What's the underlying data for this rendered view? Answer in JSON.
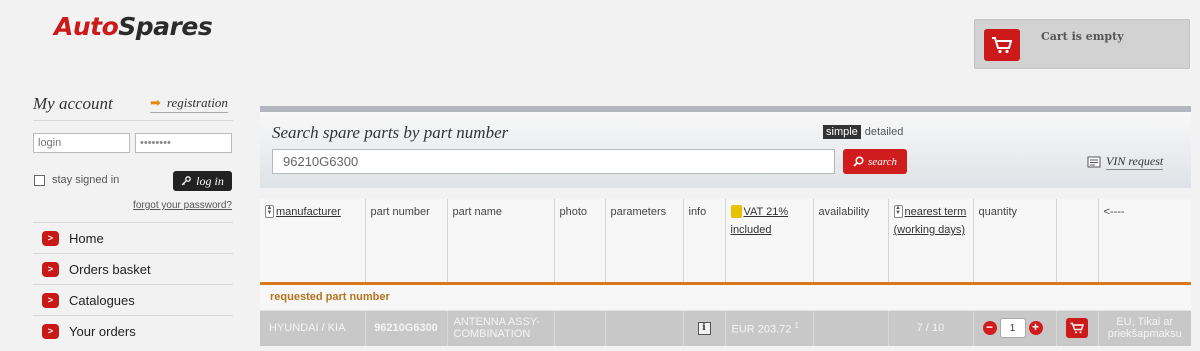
{
  "logo": {
    "part1": "Auto",
    "part2": "Spares"
  },
  "cart": {
    "status": "Cart is empty",
    "icon": "cart-icon"
  },
  "account": {
    "title": "My account",
    "registration": "registration",
    "login_placeholder": "login",
    "password_value": "••••••••",
    "stay_signed_in": "stay signed in",
    "login_button": "log in",
    "forgot_password": "forgot your password?"
  },
  "menu": {
    "items": [
      {
        "label": "Home"
      },
      {
        "label": "Orders basket"
      },
      {
        "label": "Catalogues"
      },
      {
        "label": "Your orders"
      }
    ]
  },
  "search": {
    "title": "Search spare parts by part number",
    "mode_simple": "simple",
    "mode_detailed": "detailed",
    "value": "96210G6300",
    "button": "search",
    "vin_request": "VIN request"
  },
  "table": {
    "headers": {
      "manufacturer": "manufacturer",
      "part_number": "part number",
      "part_name": "part name",
      "photo": "photo",
      "parameters": "parameters",
      "info": "info",
      "vat": "VAT 21% included",
      "availability": "availability",
      "nearest_term": "nearest term",
      "working_days": "(working days)",
      "quantity": "quantity",
      "back": "<----"
    },
    "section_label": "requested part number",
    "rows": [
      {
        "manufacturer": "HYUNDAI / KIA",
        "part_number": "96210G6300",
        "part_name": "ANTENNA ASSY-COMBINATION",
        "price": "EUR 203.72",
        "price_note": "1",
        "term": "7 / 10",
        "quantity": "1",
        "availability_note": "EU, Tikai ar priekšapmaksu"
      }
    ]
  },
  "colors": {
    "accent_red": "#cc1a1a",
    "section_orange": "#d9781c"
  }
}
